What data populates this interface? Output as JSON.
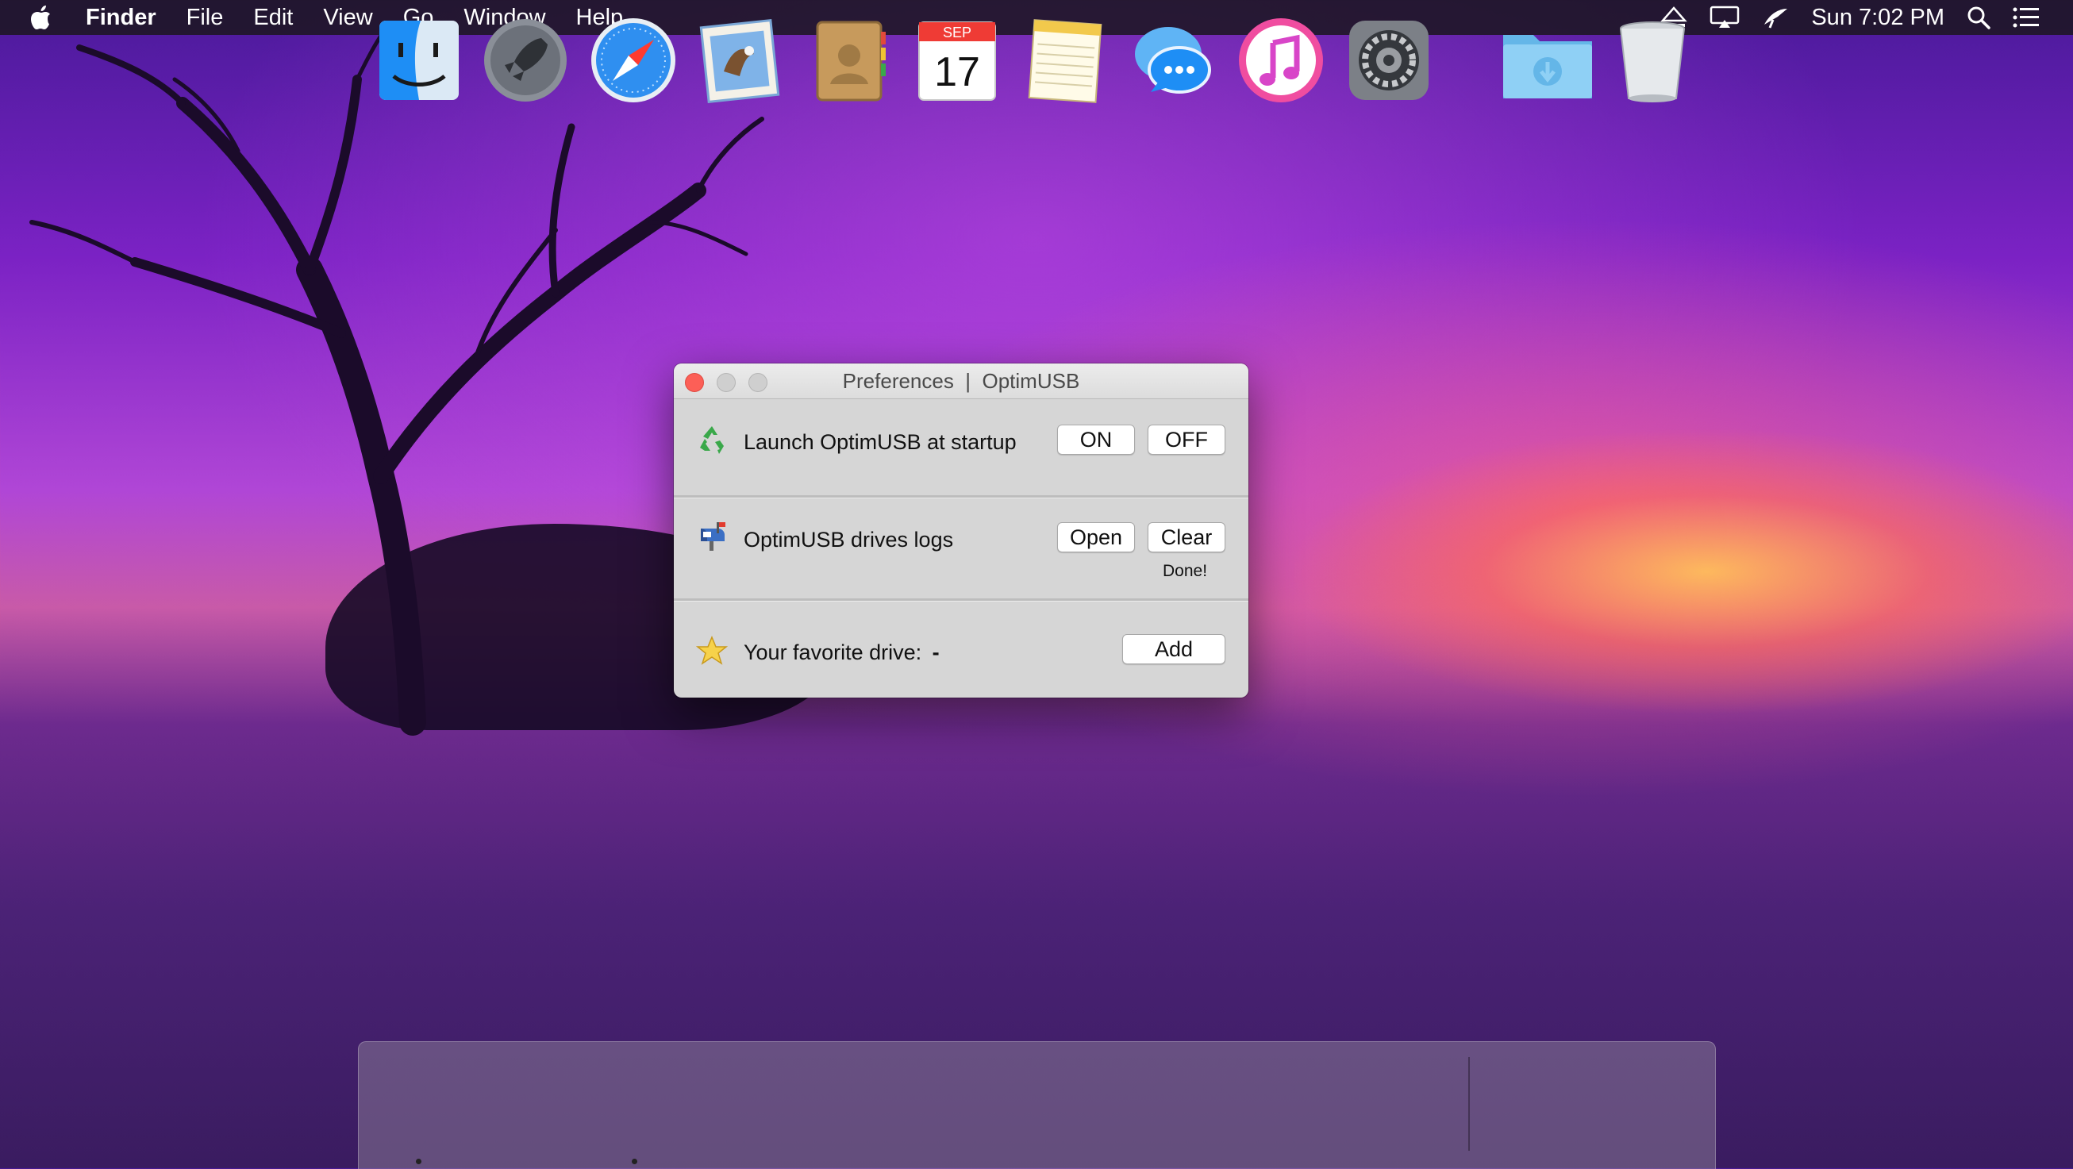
{
  "menubar": {
    "app_name": "Finder",
    "menus": [
      "File",
      "Edit",
      "View",
      "Go",
      "Window",
      "Help"
    ],
    "clock": "Sun 7:02 PM",
    "status_icons": [
      "eject-icon",
      "airplay-display-icon",
      "satellite-dish-icon",
      "spotlight-search-icon",
      "notification-center-icon"
    ]
  },
  "window": {
    "title": "Preferences  |  OptimUSB",
    "startup": {
      "icon": "recycle-icon",
      "label": "Launch OptimUSB at startup",
      "on_label": "ON",
      "off_label": "OFF"
    },
    "logs": {
      "icon": "mailbox-icon",
      "label": "OptimUSB drives logs",
      "open_label": "Open",
      "clear_label": "Clear",
      "status": "Done!"
    },
    "favorite": {
      "icon": "star-icon",
      "label": "Your favorite drive:",
      "value": "-",
      "add_label": "Add"
    }
  },
  "dock": {
    "apps": [
      "Finder",
      "Launchpad",
      "Safari",
      "Mail",
      "Contacts",
      "Calendar",
      "Notes",
      "Messages",
      "iTunes",
      "System Preferences"
    ],
    "calendar": {
      "month": "SEP",
      "day": "17"
    },
    "stack": [
      "Downloads",
      "Trash"
    ]
  },
  "colors": {
    "close_button": "#fc5f57",
    "window_bg": "#d6d6d6",
    "accent_blue": "#1e8ef5"
  }
}
